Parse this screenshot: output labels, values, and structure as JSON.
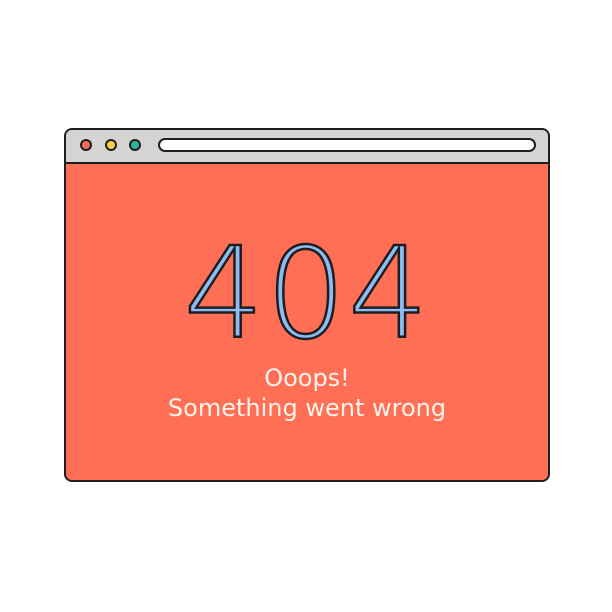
{
  "window": {
    "controls": [
      {
        "name": "close",
        "color": "#f26b5b"
      },
      {
        "name": "minimize",
        "color": "#f9cf49"
      },
      {
        "name": "zoom",
        "color": "#29b49b"
      }
    ],
    "address_bar_value": ""
  },
  "page": {
    "error_code": "404",
    "message_line_1": "Ooops!",
    "message_line_2": "Something went wrong"
  },
  "colors": {
    "page_background": "#ff6f55",
    "titlebar": "#d6d4d3",
    "error_code_fill": "#8cbcf4",
    "message_text": "#fff3ea",
    "outline": "#1e1e1e"
  }
}
